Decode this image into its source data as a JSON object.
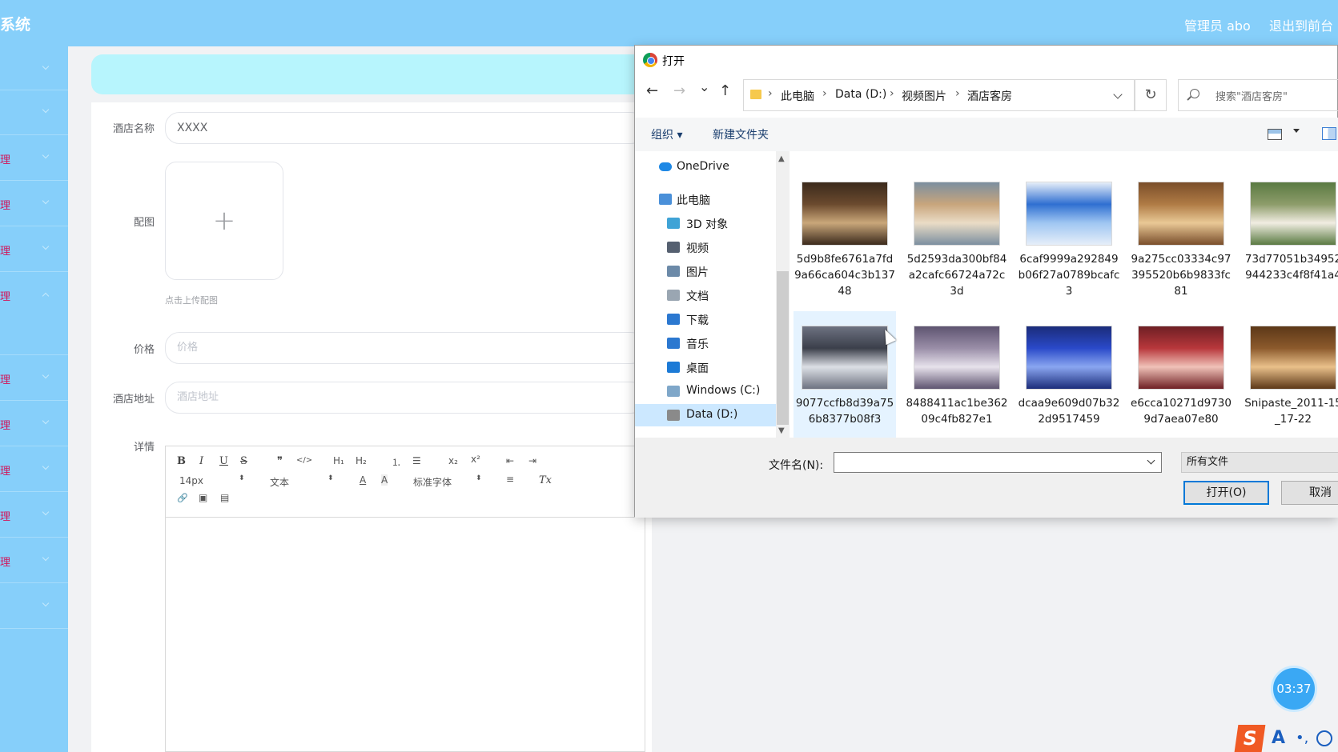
{
  "header": {
    "app_title": "系统",
    "user_label": "管理员 abo",
    "exit_label": "退出到前台"
  },
  "sidebar": {
    "items": [
      {
        "label": "",
        "chevron": "down"
      },
      {
        "label": "",
        "chevron": "down"
      },
      {
        "label": "理",
        "chevron": "down"
      },
      {
        "label": "理",
        "chevron": "down"
      },
      {
        "label": "理",
        "chevron": "down"
      },
      {
        "label": "理",
        "chevron": "up"
      },
      {
        "label": "理",
        "chevron": "down"
      },
      {
        "label": "理",
        "chevron": "down"
      },
      {
        "label": "理",
        "chevron": "down"
      },
      {
        "label": "理",
        "chevron": "down"
      },
      {
        "label": "理",
        "chevron": "down"
      },
      {
        "label": "",
        "chevron": "down"
      }
    ]
  },
  "form": {
    "hotel_name_label": "酒店名称",
    "hotel_name_value": "XXXX",
    "image_label": "配图",
    "upload_tip": "点击上传配图",
    "price_label": "价格",
    "price_placeholder": "价格",
    "address_label": "酒店地址",
    "address_placeholder": "酒店地址",
    "detail_label": "详情"
  },
  "editor_toolbar": {
    "bold": "B",
    "italic": "I",
    "underline": "U",
    "strike": "S",
    "quote": "❞",
    "code": "</>",
    "h1": "H₁",
    "h2": "H₂",
    "ordered_list": "⒈",
    "bullet_list": "☰",
    "subscript": "x₂",
    "superscript": "x²",
    "outdent": "⇤",
    "indent": "⇥",
    "font_size": "14px",
    "text_type": "文本",
    "font_color": "A",
    "background_color": "A",
    "font_family": "标准字体",
    "align": "≡",
    "clear_format": "Tx",
    "link": "🔗",
    "image": "▣",
    "video": "▤"
  },
  "dialog": {
    "title": "打开",
    "nav_back": "←",
    "nav_forward": "→",
    "nav_recent": "⌄",
    "nav_up": "↑",
    "breadcrumb": [
      "此电脑",
      "Data (D:)",
      "视频图片",
      "酒店客房"
    ],
    "refresh": "↻",
    "search_placeholder": "搜索\"酒店客房\"",
    "organize": "组织 ▾",
    "new_folder": "新建文件夹",
    "nav_pane": [
      {
        "label": "OneDrive",
        "icon": "cloud-icon",
        "color": "#1e88e5",
        "indent": 0,
        "selected": false
      },
      {
        "label": "此电脑",
        "icon": "computer-icon",
        "color": "#4a90d9",
        "indent": 0,
        "selected": false
      },
      {
        "label": "3D 对象",
        "icon": "cube-icon",
        "color": "#3fa3d6",
        "indent": 1,
        "selected": false
      },
      {
        "label": "视频",
        "icon": "video-icon",
        "color": "#556070",
        "indent": 1,
        "selected": false
      },
      {
        "label": "图片",
        "icon": "picture-icon",
        "color": "#6c8aa8",
        "indent": 1,
        "selected": false
      },
      {
        "label": "文档",
        "icon": "document-icon",
        "color": "#9aa6b2",
        "indent": 1,
        "selected": false
      },
      {
        "label": "下载",
        "icon": "download-icon",
        "color": "#2b78d0",
        "indent": 1,
        "selected": false
      },
      {
        "label": "音乐",
        "icon": "music-icon",
        "color": "#2b78d0",
        "indent": 1,
        "selected": false
      },
      {
        "label": "桌面",
        "icon": "desktop-icon",
        "color": "#1c7ad6",
        "indent": 1,
        "selected": false
      },
      {
        "label": "Windows (C:)",
        "icon": "drive-icon",
        "color": "#7fa7c9",
        "indent": 1,
        "selected": false
      },
      {
        "label": "Data (D:)",
        "icon": "drive-icon",
        "color": "#8a8a8a",
        "indent": 1,
        "selected": true
      }
    ],
    "files": [
      {
        "name": "5d9b8fe6761a7fd9a66ca604c3b13748",
        "colors": [
          "#6b4a2e",
          "#c9a77a",
          "#3b2a1c"
        ]
      },
      {
        "name": "5d2593da300bf84a2cafc66724a72c3d",
        "colors": [
          "#c8a57c",
          "#eadcc6",
          "#7c8fa0"
        ]
      },
      {
        "name": "6caf9999a292849b06f27a0789bcafc3",
        "colors": [
          "#2f6fd1",
          "#9fc6f2",
          "#e6eef9"
        ]
      },
      {
        "name": "9a275cc03334c97395520b6b9833fc81",
        "colors": [
          "#b07b45",
          "#e9c996",
          "#7a4e2a"
        ]
      },
      {
        "name": "73d77051b34952944233c4f8f41a4",
        "colors": [
          "#8d9c6a",
          "#f1ede2",
          "#5a7a42"
        ]
      },
      {
        "name": "9077ccfb8d39a756b8377b08f3",
        "colors": [
          "#3b3f4a",
          "#dcdfe5",
          "#6d7281"
        ]
      },
      {
        "name": "8488411ac1be36209c4fb827e1",
        "colors": [
          "#9a8ea8",
          "#e7e2ec",
          "#5e5470"
        ]
      },
      {
        "name": "dcaa9e609d07b322d9517459",
        "colors": [
          "#2a49c9",
          "#89a6f0",
          "#1b2c7a"
        ]
      },
      {
        "name": "e6cca10271d97309d7aea07e80",
        "colors": [
          "#b8373b",
          "#f0c2b8",
          "#6e1f24"
        ]
      },
      {
        "name": "Snipaste_2011-15_17-22",
        "colors": [
          "#8c5a2c",
          "#e9c08a",
          "#5c3818"
        ]
      }
    ],
    "file_name_label": "文件名(N):",
    "file_name_value": "",
    "file_type": "所有文件",
    "open_button": "打开(O)",
    "cancel_button": "取消"
  },
  "recording_timer": "03:37",
  "ime": {
    "logo": "S",
    "mode": "A",
    "punct": "•,"
  }
}
